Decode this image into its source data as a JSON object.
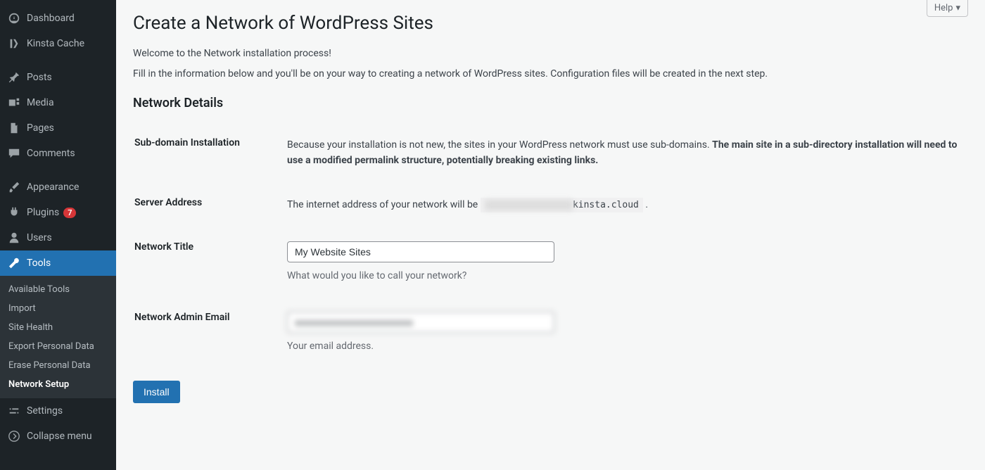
{
  "sidebar": {
    "items": [
      {
        "label": "Dashboard",
        "icon": "dashboard"
      },
      {
        "label": "Kinsta Cache",
        "icon": "kinsta"
      },
      {
        "label": "Posts",
        "icon": "pin"
      },
      {
        "label": "Media",
        "icon": "media"
      },
      {
        "label": "Pages",
        "icon": "page"
      },
      {
        "label": "Comments",
        "icon": "comment"
      },
      {
        "label": "Appearance",
        "icon": "brush"
      },
      {
        "label": "Plugins",
        "icon": "plug",
        "badge": "7"
      },
      {
        "label": "Users",
        "icon": "user"
      },
      {
        "label": "Tools",
        "icon": "wrench",
        "active": true
      },
      {
        "label": "Settings",
        "icon": "settings"
      }
    ],
    "submenu": [
      {
        "label": "Available Tools"
      },
      {
        "label": "Import"
      },
      {
        "label": "Site Health"
      },
      {
        "label": "Export Personal Data"
      },
      {
        "label": "Erase Personal Data"
      },
      {
        "label": "Network Setup",
        "current": true
      }
    ],
    "collapse_label": "Collapse menu"
  },
  "help": {
    "label": "Help"
  },
  "page": {
    "title": "Create a Network of WordPress Sites",
    "intro1": "Welcome to the Network installation process!",
    "intro2": "Fill in the information below and you'll be on your way to creating a network of WordPress sites. Configuration files will be created in the next step.",
    "section_heading": "Network Details"
  },
  "form": {
    "subdomain": {
      "label": "Sub-domain Installation",
      "text_a": "Because your installation is not new, the sites in your WordPress network must use sub-domains. ",
      "text_b": "The main site in a sub-directory installation will need to use a modified permalink structure, potentially breaking existing links."
    },
    "server": {
      "label": "Server Address",
      "text_a": "The internet address of your network will be ",
      "code_blur": "xxxxxxxxxxxxxxxx",
      "code_vis": "kinsta.cloud",
      "text_b": " ."
    },
    "title": {
      "label": "Network Title",
      "value": "My Website Sites",
      "hint": "What would you like to call your network?"
    },
    "email": {
      "label": "Network Admin Email",
      "value": "xxxxxxxxxxxxxxxxxxxxxxxx",
      "hint": "Your email address."
    },
    "submit_label": "Install"
  }
}
